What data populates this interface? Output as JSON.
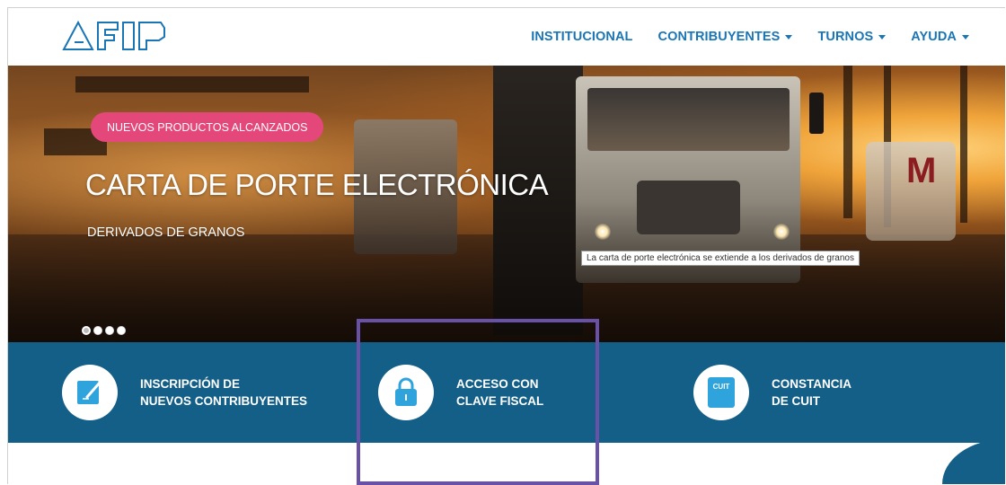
{
  "header": {
    "logo_text": "AFIP",
    "nav": [
      {
        "label": "INSTITUCIONAL",
        "dropdown": false
      },
      {
        "label": "CONTRIBUYENTES",
        "dropdown": true
      },
      {
        "label": "TURNOS",
        "dropdown": true
      },
      {
        "label": "AYUDA",
        "dropdown": true
      }
    ]
  },
  "hero": {
    "badge": "NUEVOS PRODUCTOS ALCANZADOS",
    "title": "CARTA DE PORTE ELECTRÓNICA",
    "subtitle": "DERIVADOS DE GRANOS",
    "tooltip": "La carta de porte electrónica se extiende a los derivados de granos",
    "slides_total": 4,
    "active_slide": 1,
    "badge_color": "#e4477a"
  },
  "quick_access": [
    {
      "line1": "INSCRIPCIÓN DE",
      "line2": "NUEVOS CONTRIBUYENTES",
      "icon": "edit-document-icon"
    },
    {
      "line1": "ACCESO CON",
      "line2": "CLAVE FISCAL",
      "icon": "lock-icon"
    },
    {
      "line1": "CONSTANCIA",
      "line2": "DE CUIT",
      "icon": "cuit-card-icon",
      "icon_text": "CUIT"
    }
  ],
  "colors": {
    "nav_blue": "#1a75b5",
    "band_blue": "#135f88",
    "icon_blue": "#2ea3dc",
    "highlight": "#6a51a8"
  }
}
